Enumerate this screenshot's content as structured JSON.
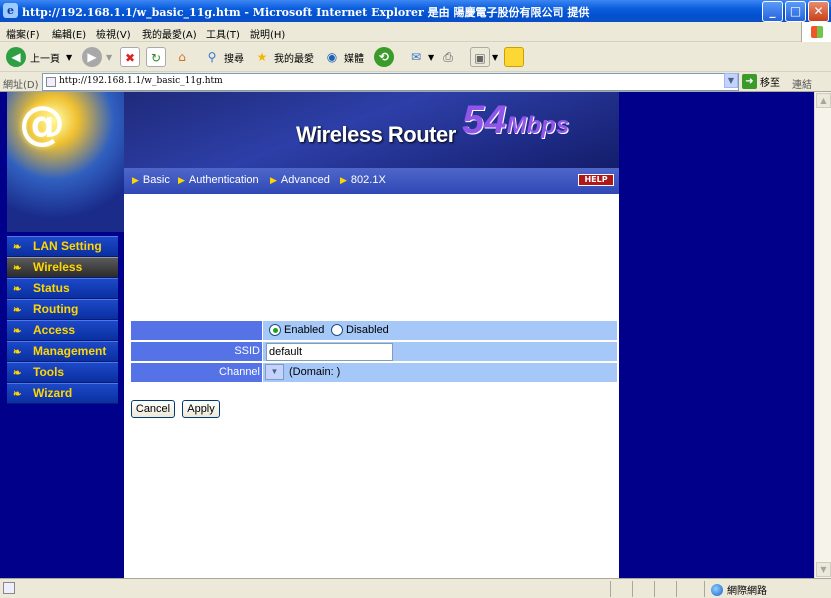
{
  "window": {
    "title": "http://192.168.1.1/w_basic_11g.htm - Microsoft Internet Explorer 是由 陽慶電子股份有限公司 提供",
    "minimize": "_",
    "maximize": "□",
    "close": "✕"
  },
  "menu": [
    "檔案(F)",
    "編輯(E)",
    "檢視(V)",
    "我的最愛(A)",
    "工具(T)",
    "說明(H)"
  ],
  "toolbar": {
    "back": "上一頁",
    "search": "搜尋",
    "favorites": "我的最愛",
    "media": "媒體"
  },
  "address": {
    "label": "網址(D)",
    "url": "http://192.168.1.1/w_basic_11g.htm",
    "go": "移至",
    "links": "連結"
  },
  "banner": {
    "product": "Wireless Router",
    "speed": "54",
    "unit": "Mbps"
  },
  "breadcrumb": [
    "Basic",
    "Authentication",
    "Advanced",
    "802.1X"
  ],
  "help": "HELP",
  "nav": [
    "LAN Setting",
    "Wireless",
    "Status",
    "Routing",
    "Access",
    "Management",
    "Tools",
    "Wizard"
  ],
  "form": {
    "enabled_label": "Enabled",
    "disabled_label": "Disabled",
    "ssid_label": "SSID",
    "ssid_value": "default",
    "channel_label": "Channel",
    "domain_text": "(Domain: )"
  },
  "buttons": {
    "cancel": "Cancel",
    "apply": "Apply"
  },
  "status": {
    "zone": "網際網路"
  }
}
